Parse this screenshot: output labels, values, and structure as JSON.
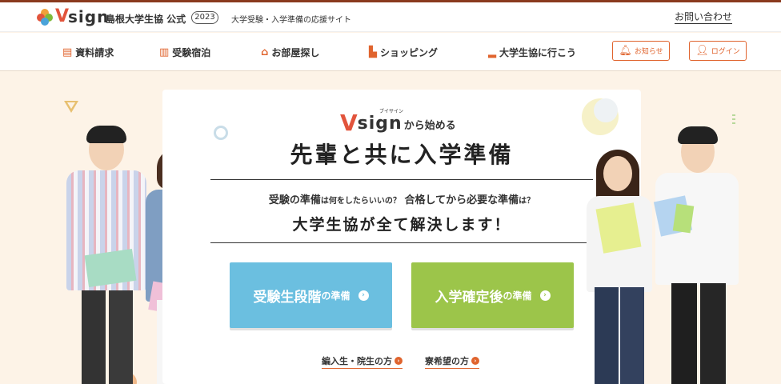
{
  "header": {
    "brand": "Vsign",
    "brand_v": "V",
    "brand_rest": "sign",
    "university": "島根大学生協 公式",
    "year": "2023",
    "tagline": "大学受験・入学準備の応援サイト",
    "contact_link": "お問い合わせ"
  },
  "nav": {
    "items": [
      {
        "label": "資料請求",
        "icon": "document-icon"
      },
      {
        "label": "受験宿泊",
        "icon": "building-icon"
      },
      {
        "label": "お部屋探し",
        "icon": "house-icon"
      },
      {
        "label": "ショッピング",
        "icon": "cart-icon"
      },
      {
        "label": "大学生協に行こう",
        "icon": "shoe-icon"
      }
    ],
    "notice_label": "お知らせ",
    "login_label": "ログイン"
  },
  "hero": {
    "vsign_v": "V",
    "vsign_rest": "sign",
    "vsign_ruby": "ブイサイン",
    "vsign_suffix": "から始める",
    "headline": "先輩と共に入学準備",
    "sub_q1_a": "受験の準備",
    "sub_q1_b": "は何をしたらいいの？",
    "sub_q2_a": "合格してから必要な準備",
    "sub_q2_b": "は？",
    "sub_answer": "大学生協が全て解決します！",
    "cta_exam_big": "受験生段階",
    "cta_exam_small": "の準備",
    "cta_admission_big": "入学確定後",
    "cta_admission_small": "の準備",
    "link_transfer": "編入生・院生の方",
    "link_dorm": "寮希望の方"
  },
  "colors": {
    "accent": "#e0642e",
    "brand_red": "#e2543c",
    "cta_blue": "#6bbfe0",
    "cta_green": "#9cc54a",
    "background": "#fdf3e7"
  }
}
